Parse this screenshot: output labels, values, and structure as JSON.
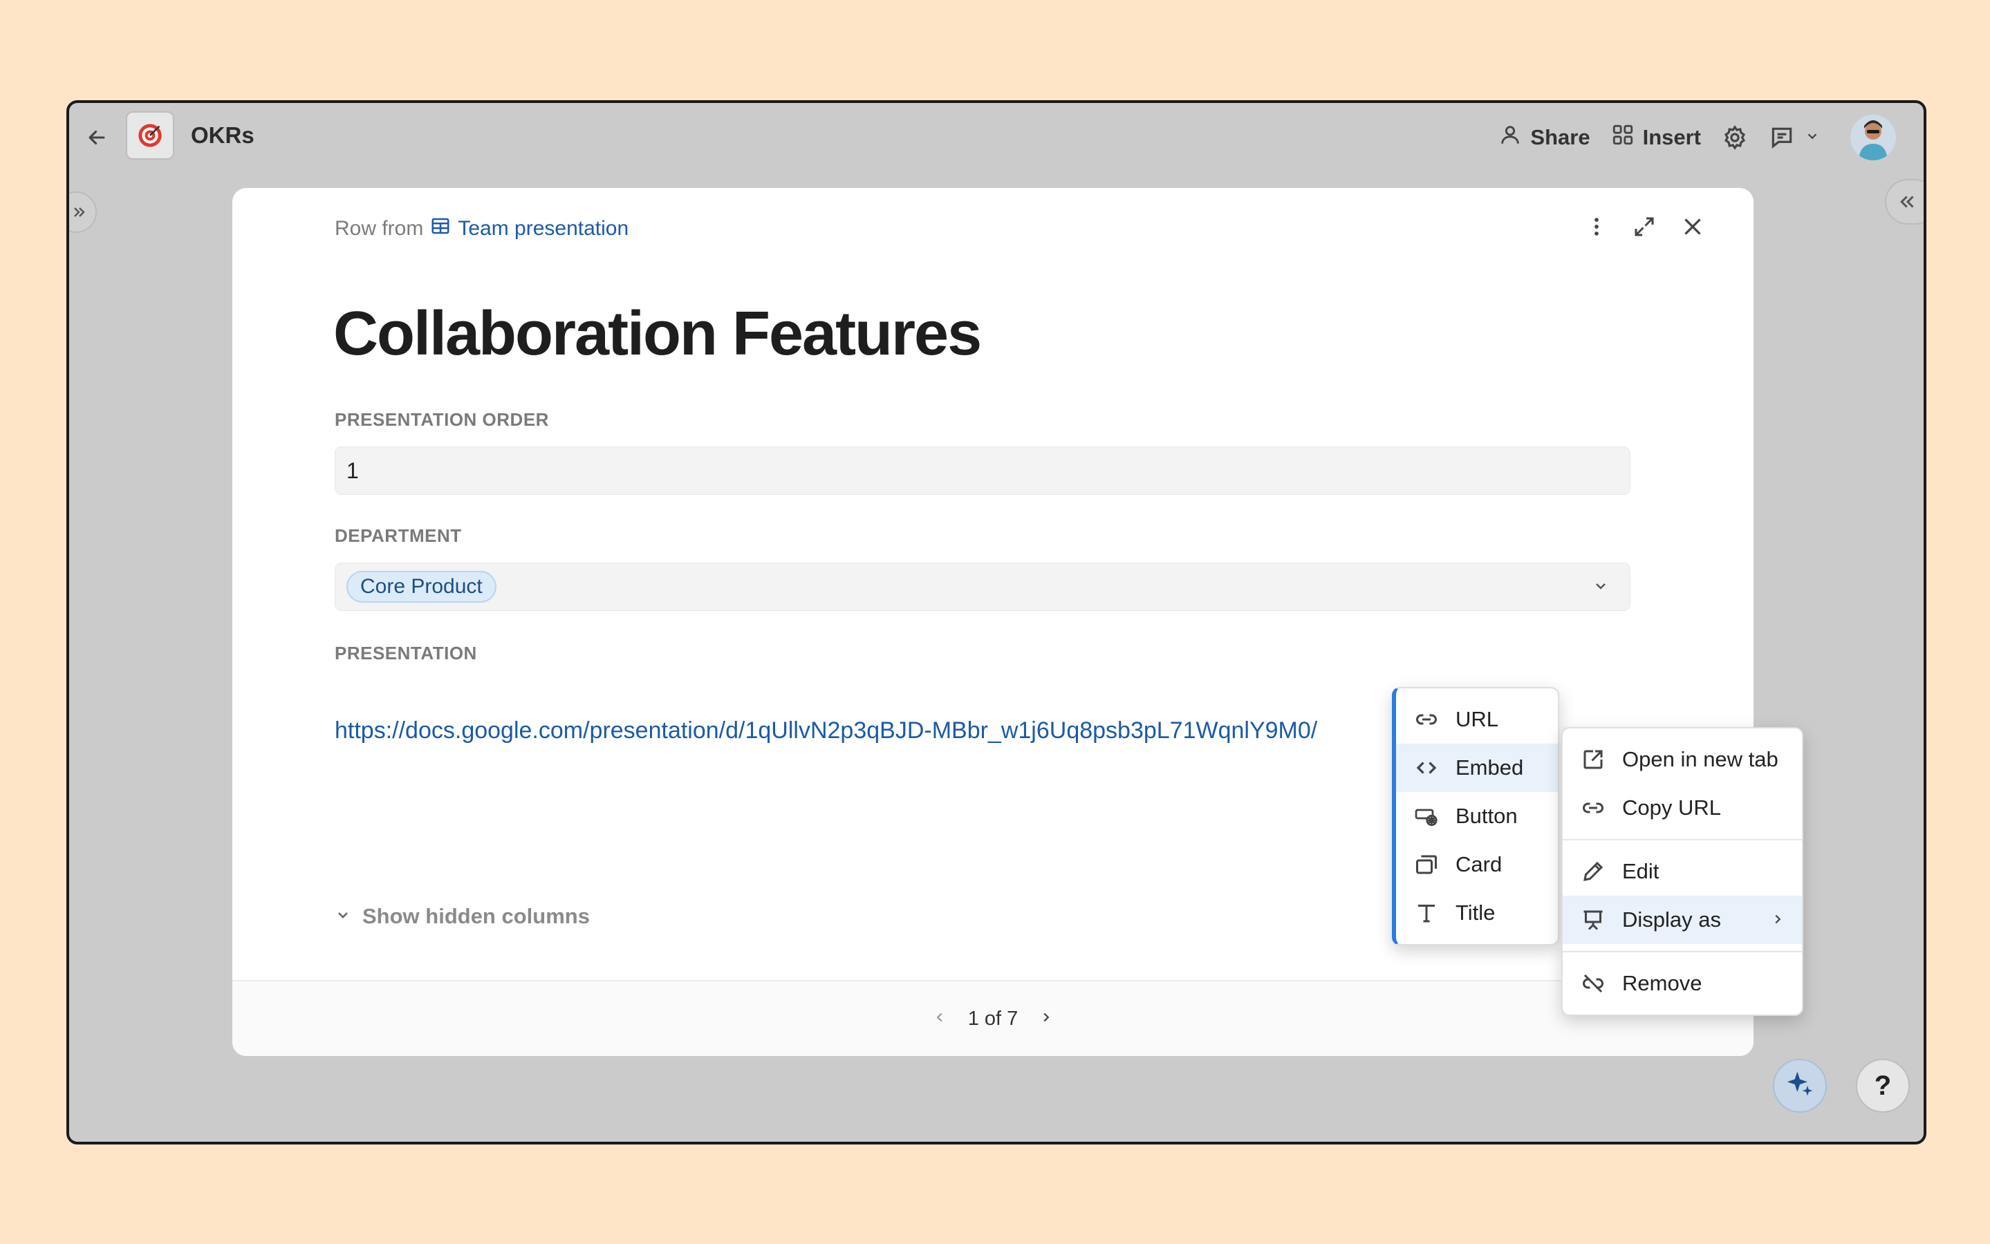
{
  "app": {
    "title": "OKRs",
    "share_label": "Share",
    "insert_label": "Insert"
  },
  "modal": {
    "breadcrumb_prefix": "Row from",
    "table_name": "Team presentation",
    "row_title": "Collaboration Features",
    "fields": {
      "presentation_order": {
        "label": "PRESENTATION ORDER",
        "value": "1"
      },
      "department": {
        "label": "DEPARTMENT",
        "value": "Core Product"
      },
      "presentation": {
        "label": "PRESENTATION",
        "value": "https://docs.google.com/presentation/d/1qUllvN2p3qBJD-MBbr_w1j6Uq8psb3pL71WqnlY9M0/"
      }
    },
    "show_hidden_label": "Show hidden columns",
    "pager": "1 of 7"
  },
  "display_menu": {
    "items": [
      {
        "label": "URL",
        "icon": "link-icon"
      },
      {
        "label": "Embed",
        "icon": "code-icon",
        "active": true
      },
      {
        "label": "Button",
        "icon": "button-icon"
      },
      {
        "label": "Card",
        "icon": "card-icon"
      },
      {
        "label": "Title",
        "icon": "text-icon"
      }
    ]
  },
  "context_menu": {
    "open_new_tab": "Open in new tab",
    "copy_url": "Copy URL",
    "edit": "Edit",
    "display_as": "Display as",
    "remove": "Remove"
  },
  "colors": {
    "background": "#ffe5c8",
    "accent": "#1a5aa8",
    "active_item": "#e9f1fa"
  }
}
